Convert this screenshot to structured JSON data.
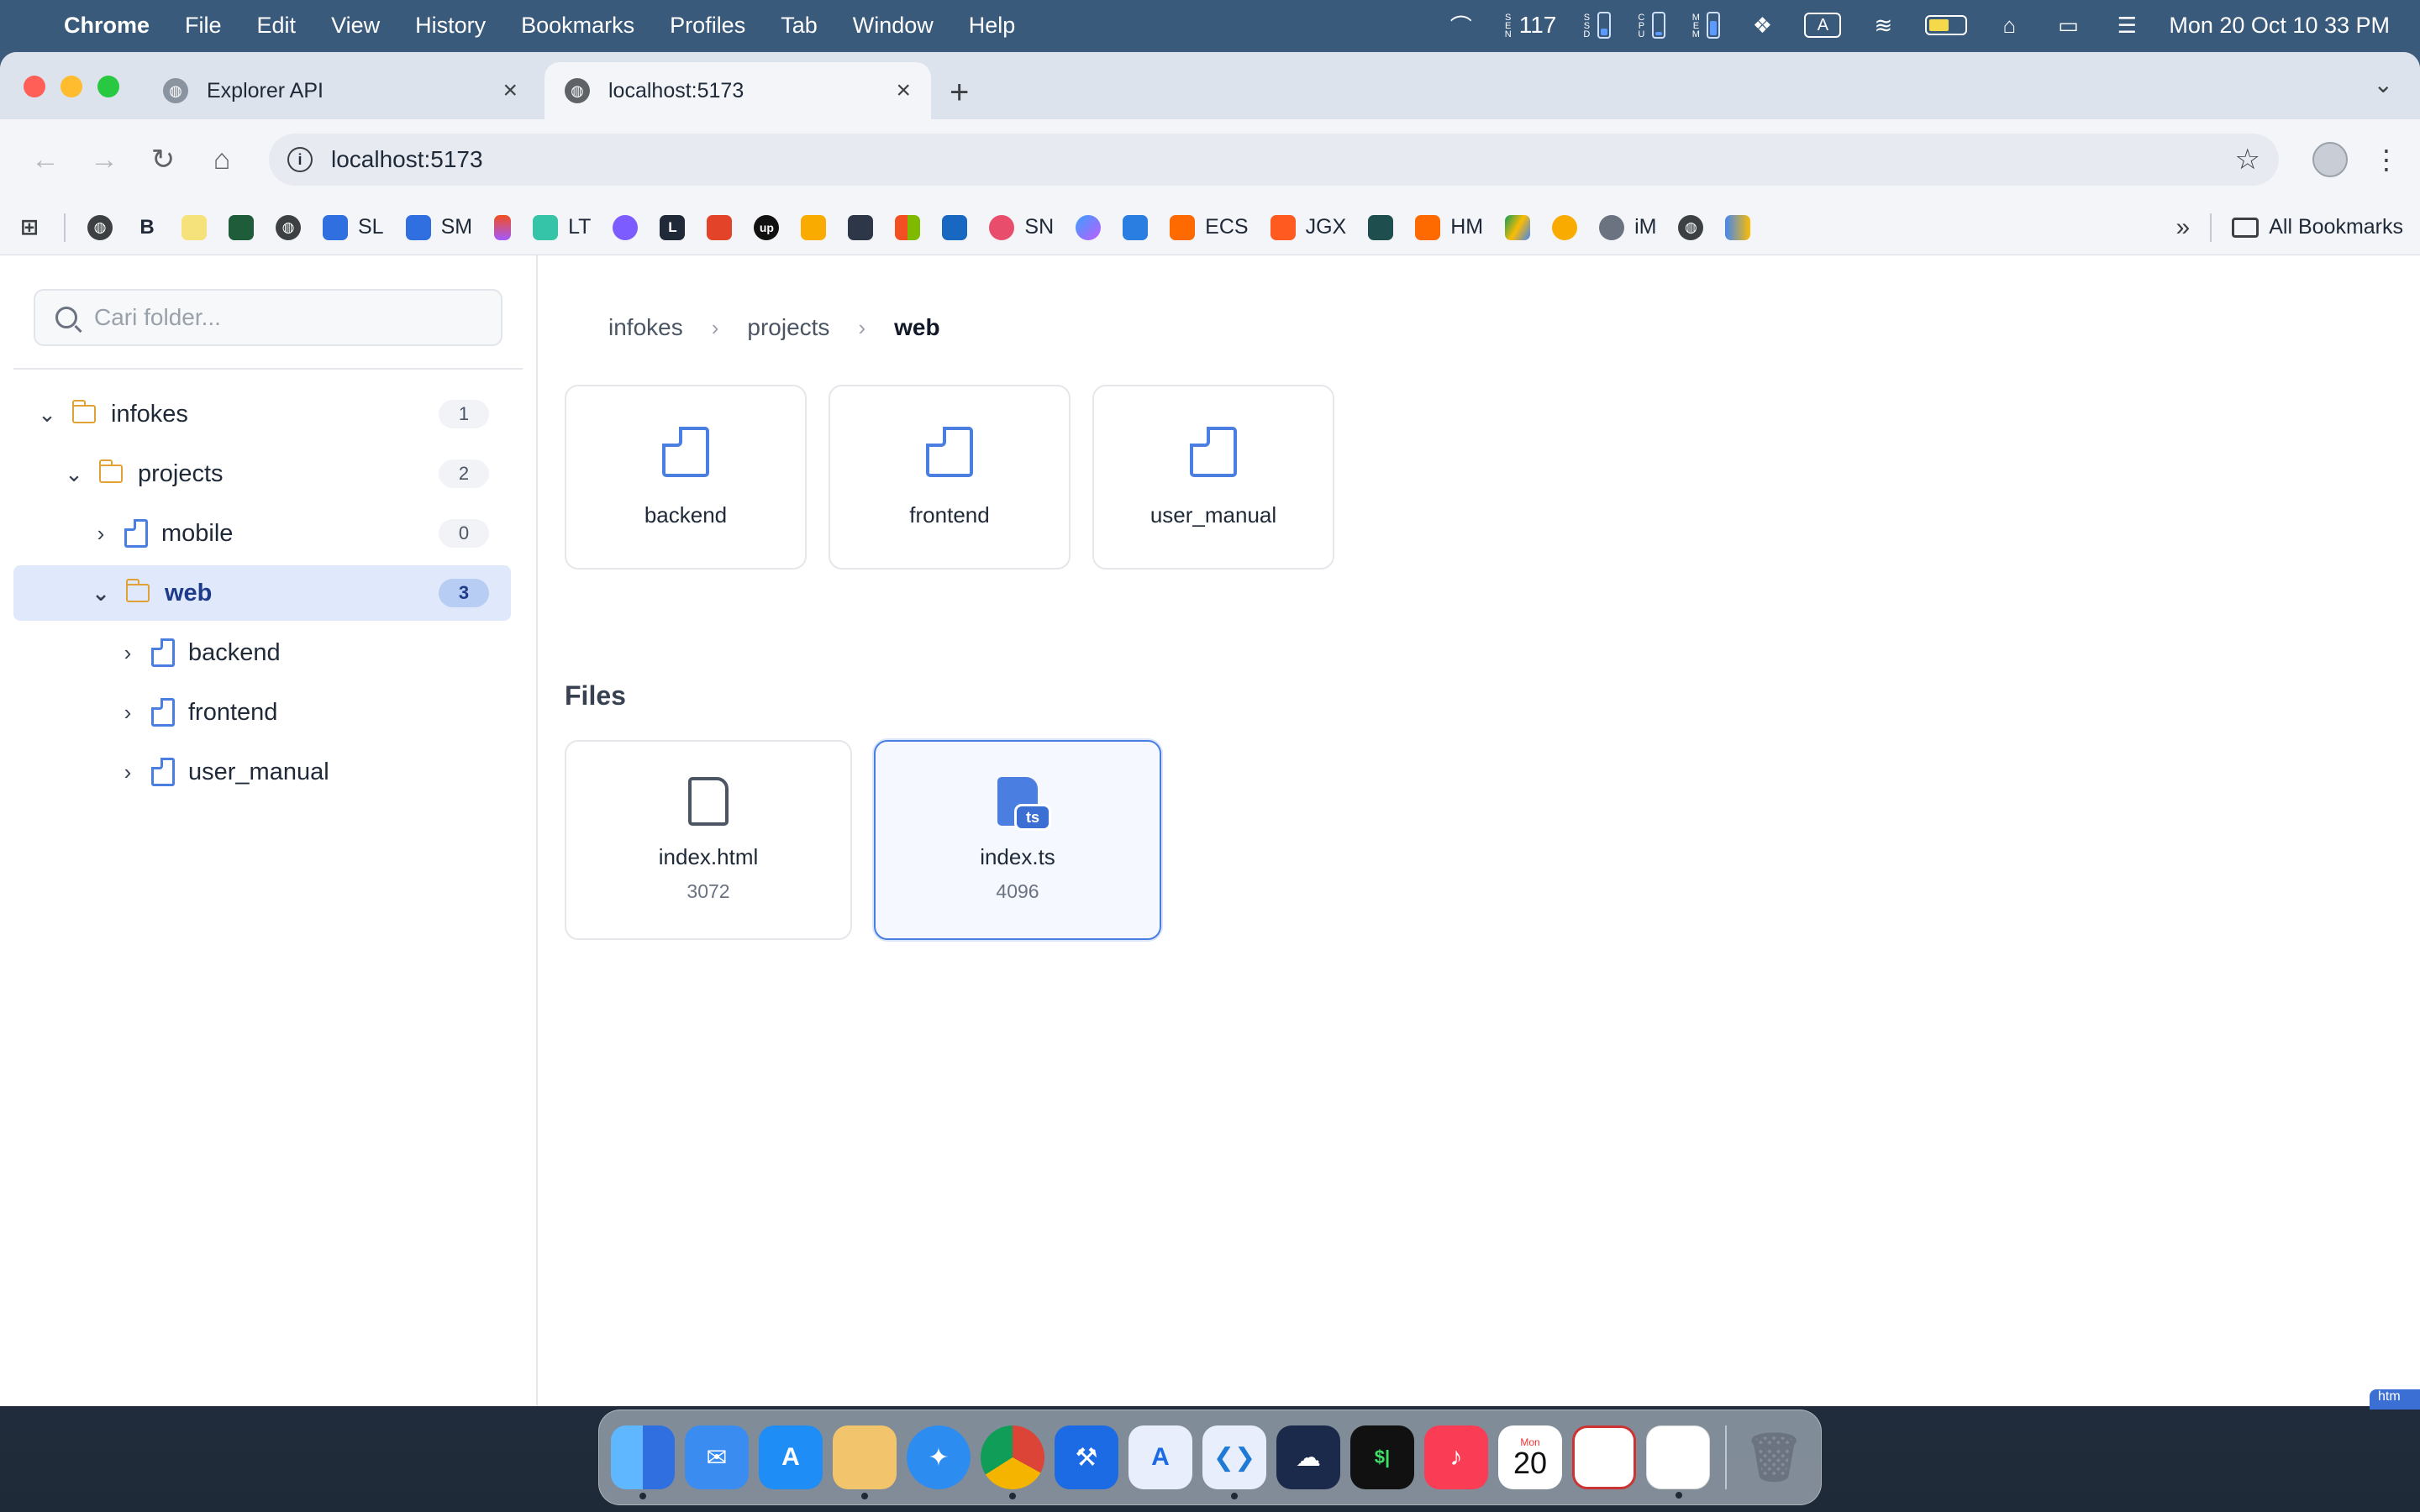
{
  "menubar": {
    "app_name": "Chrome",
    "items": [
      "File",
      "Edit",
      "View",
      "History",
      "Bookmarks",
      "Profiles",
      "Tab",
      "Window",
      "Help"
    ],
    "sen_label": "SEN",
    "sen_value": "117",
    "ssd_label": "SSD",
    "cpu_label": "CPU",
    "mem_label": "MEM",
    "input_source": "A",
    "clock": "Mon 20 Oct  10 33 PM"
  },
  "browser": {
    "tabs": [
      {
        "title": "Explorer API"
      },
      {
        "title": "localhost:5173"
      }
    ],
    "url": "localhost:5173",
    "bookmarks": [
      "SL",
      "SM",
      "LT",
      "SN",
      "ECS",
      "JGX",
      "HM",
      "iM"
    ],
    "all_bookmarks_label": "All Bookmarks"
  },
  "sidebar": {
    "search_placeholder": "Cari folder...",
    "tree": [
      {
        "name": "infokes",
        "count": "1"
      },
      {
        "name": "projects",
        "count": "2"
      },
      {
        "name": "mobile",
        "count": "0"
      },
      {
        "name": "web",
        "count": "3"
      },
      {
        "name": "backend"
      },
      {
        "name": "frontend"
      },
      {
        "name": "user_manual"
      }
    ]
  },
  "main": {
    "breadcrumb": [
      "infokes",
      "projects",
      "web"
    ],
    "folders": [
      "backend",
      "frontend",
      "user_manual"
    ],
    "files_title": "Files",
    "files": [
      {
        "name": "index.html",
        "size": "3072"
      },
      {
        "name": "index.ts",
        "size": "4096",
        "badge": "ts"
      }
    ]
  },
  "dock": {
    "calendar_month": "Mon",
    "calendar_day": "20",
    "terminal_label": "$|"
  },
  "corner_tag": "htm"
}
